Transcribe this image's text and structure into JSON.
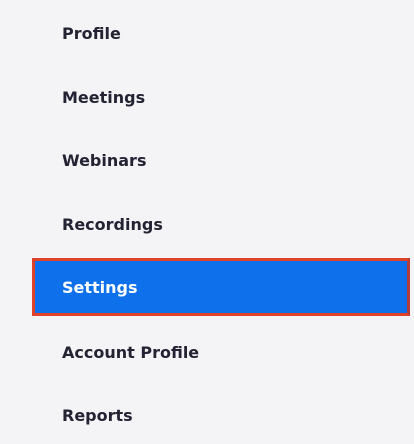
{
  "sidebar": {
    "items": [
      {
        "id": "profile",
        "label": "Profile",
        "active": false
      },
      {
        "id": "meetings",
        "label": "Meetings",
        "active": false
      },
      {
        "id": "webinars",
        "label": "Webinars",
        "active": false
      },
      {
        "id": "recordings",
        "label": "Recordings",
        "active": false
      },
      {
        "id": "settings",
        "label": "Settings",
        "active": true
      },
      {
        "id": "account-profile",
        "label": "Account Profile",
        "active": false
      },
      {
        "id": "reports",
        "label": "Reports",
        "active": false
      }
    ]
  },
  "colors": {
    "background": "#f4f4f6",
    "text": "#232333",
    "active_background": "#0e71eb",
    "active_text": "#ffffff",
    "highlight_border": "#e0412a"
  }
}
